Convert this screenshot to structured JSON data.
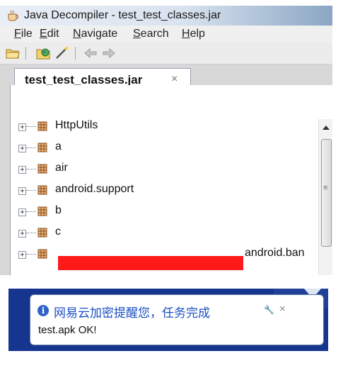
{
  "window": {
    "title": "Java Decompiler - test_test_classes.jar"
  },
  "menu": [
    "File",
    "Edit",
    "Navigate",
    "Search",
    "Help"
  ],
  "toolbar": {
    "buttons": [
      "open-file-icon",
      "open-type-icon",
      "wand-icon",
      "back-arrow-icon",
      "forward-arrow-icon"
    ]
  },
  "tab": {
    "label": "test_test_classes.jar",
    "close_glyph": "×"
  },
  "tree": {
    "expander_glyph": "+",
    "nodes": [
      "HttpUtils",
      "a",
      "air",
      "android.support",
      "b",
      "c",
      "android.ban"
    ]
  },
  "scrollbar": {
    "grip_glyph": "≡"
  },
  "notification": {
    "title": "网易云加密提醒您，任务完成",
    "message": "test.apk OK!",
    "close_glyph": "×",
    "info_glyph": "i",
    "wrench_glyph": "🔧"
  },
  "colors": {
    "taskbar": "#16358f",
    "redaction": "#ff1a1a",
    "title_link": "#1b4fc2"
  }
}
